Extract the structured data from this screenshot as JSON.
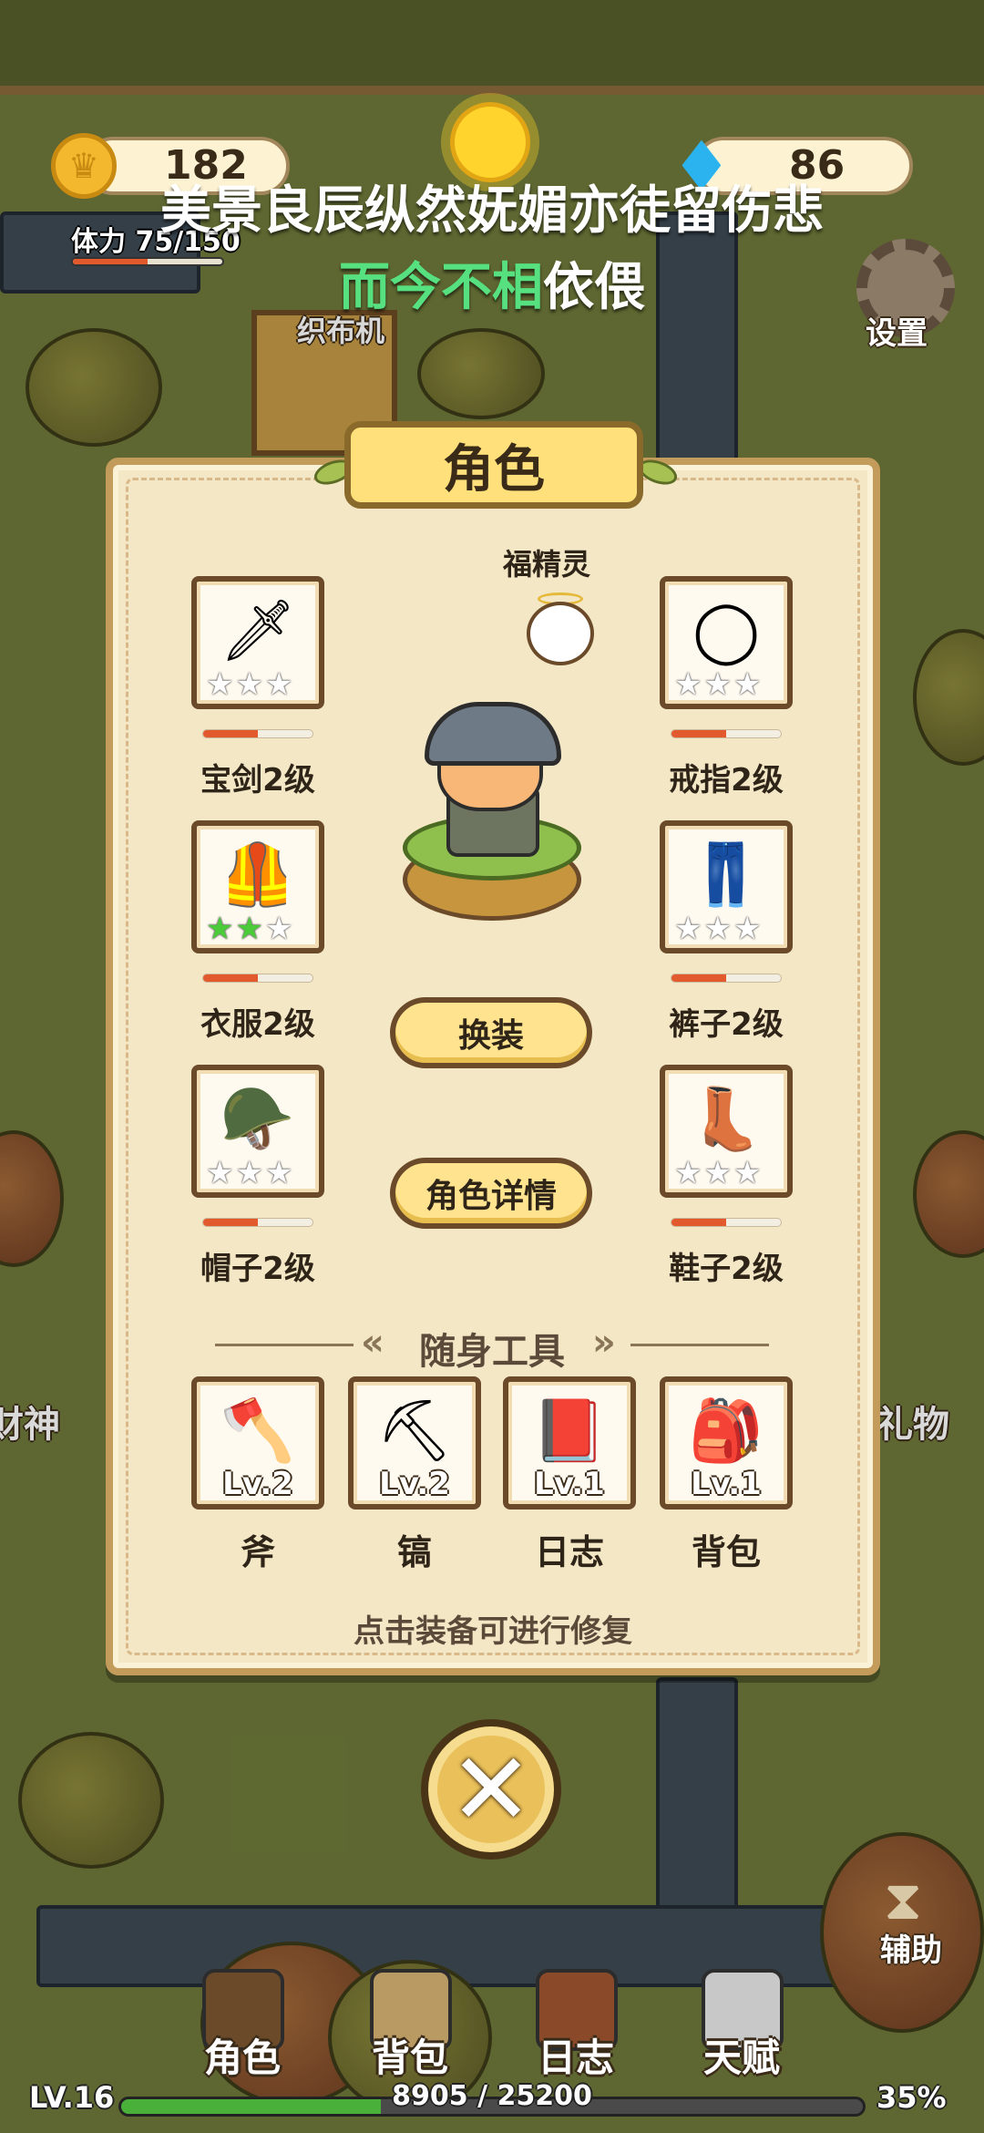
{
  "hud": {
    "coins": "182",
    "gems": "86",
    "stamina_text": "体力 75/150",
    "stamina_fraction": 0.5
  },
  "subtitle": {
    "line1": "美景良辰纵然妩媚亦徒留伤悲",
    "line2_highlight": "而今不相",
    "line2_rest": "依偎"
  },
  "world": {
    "settings_label": "设置",
    "loom_label": "织布机",
    "gift_label": "礼物",
    "statue_label": "财神",
    "assist_label": "辅助"
  },
  "panel": {
    "title": "角色",
    "fairy_name": "福精灵",
    "change_outfit_button": "换装",
    "details_button": "角色详情",
    "repair_hint": "点击装备可进行修复",
    "tools_title": "随身工具",
    "equipment": [
      {
        "label": "宝剑2级",
        "icon": "sword-icon",
        "glyph": "🗡",
        "stars_on": 0,
        "durability": 0.5
      },
      {
        "label": "戒指2级",
        "icon": "ring-icon",
        "glyph": "◯",
        "stars_on": 0,
        "durability": 0.5
      },
      {
        "label": "衣服2级",
        "icon": "vest-icon",
        "glyph": "🦺",
        "stars_on": 2,
        "durability": 0.5
      },
      {
        "label": "裤子2级",
        "icon": "pants-icon",
        "glyph": "👖",
        "stars_on": 0,
        "durability": 0.5
      },
      {
        "label": "帽子2级",
        "icon": "hat-icon",
        "glyph": "🪖",
        "stars_on": 0,
        "durability": 0.5
      },
      {
        "label": "鞋子2级",
        "icon": "boot-icon",
        "glyph": "👢",
        "stars_on": 0,
        "durability": 0.5
      }
    ],
    "tools": [
      {
        "label": "斧",
        "level": "Lv.2",
        "icon": "axe-icon",
        "glyph": "🪓"
      },
      {
        "label": "镐",
        "level": "Lv.2",
        "icon": "pickaxe-icon",
        "glyph": "⛏"
      },
      {
        "label": "日志",
        "level": "Lv.1",
        "icon": "journal-icon",
        "glyph": "📕"
      },
      {
        "label": "背包",
        "level": "Lv.1",
        "icon": "backpack-icon",
        "glyph": "🎒"
      }
    ]
  },
  "nav": [
    {
      "label": "角色",
      "icon": "character-icon"
    },
    {
      "label": "背包",
      "icon": "backpack-icon"
    },
    {
      "label": "日志",
      "icon": "journal-icon"
    },
    {
      "label": "天赋",
      "icon": "talent-icon"
    }
  ],
  "progress": {
    "level_text": "LV.16",
    "xp_text": "8905 / 25200",
    "percent_text": "35%",
    "fraction": 0.35
  },
  "colors": {
    "panel_bg": "#f3e7c6",
    "accent_gold": "#ffe38e",
    "durability": "#e2592e",
    "star_on": "#4ccb3a",
    "xp_fill": "#49b03a"
  }
}
